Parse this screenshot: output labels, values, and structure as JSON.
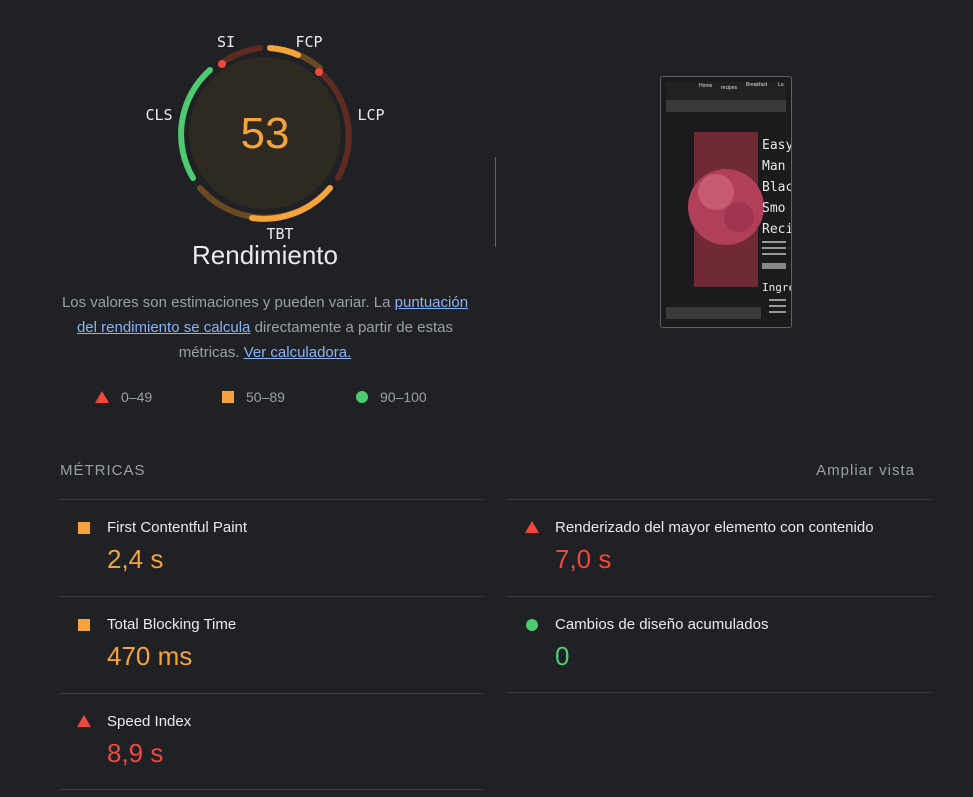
{
  "gauge": {
    "score": "53",
    "labels": {
      "si": "SI",
      "fcp": "FCP",
      "lcp": "LCP",
      "tbt": "TBT",
      "cls": "CLS"
    },
    "title": "Rendimiento"
  },
  "description": {
    "text_before": "Los valores son estimaciones y pueden variar. La ",
    "link1": "puntuación del rendimiento se calcula",
    "text_middle": " directamente a partir de estas métricas. ",
    "link2": "Ver calculadora."
  },
  "legend": {
    "fail": "0–49",
    "average": "50–89",
    "pass": "90–100"
  },
  "thumbnail": {
    "nav": [
      "Home",
      "recipes",
      "Breakfast",
      "Lu"
    ],
    "heading_lines": [
      "Easy",
      "Man",
      "Black",
      "Smo",
      "Reci"
    ],
    "ingredients": "Ingre"
  },
  "metrics": {
    "title": "MÉTRICAS",
    "expand_label": "Ampliar vista",
    "fcp": {
      "name": "First Contentful Paint",
      "value": "2,4 s"
    },
    "lcp": {
      "name": "Renderizado del mayor elemento con contenido",
      "value": "7,0 s"
    },
    "tbt": {
      "name": "Total Blocking Time",
      "value": "470 ms"
    },
    "cls": {
      "name": "Cambios de diseño acumulados",
      "value": "0"
    },
    "si": {
      "name": "Speed Index",
      "value": "8,9 s"
    }
  },
  "colors": {
    "fail": "#f4473b",
    "average": "#f4a33d",
    "pass": "#4ecb71",
    "background": "#202124"
  }
}
